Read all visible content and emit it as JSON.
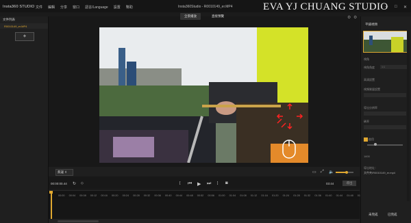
{
  "app": {
    "name": "Insta360 STUDIO",
    "document_title": "Insta360Studio - R0010149_er.MP4",
    "watermark": "EVA YJ CHUANG STUDIO"
  },
  "menu": [
    "文件",
    "編輯",
    "分享",
    "窗口",
    "語言/Language",
    "設置",
    "幫助"
  ],
  "window_controls": {
    "minimize": "─",
    "maximize": "□",
    "close": "✕"
  },
  "left_panel": {
    "header": "文件列表",
    "files": [
      "R0010149_er.MP4"
    ],
    "add_label": "+"
  },
  "view_modes": {
    "active": "全景播放",
    "other": "直接預覽"
  },
  "controls": {
    "dropdown_value": "無邊 ⇕",
    "time_current": "00:00:00.44",
    "time_total": "03:44",
    "export_label": "導出",
    "volume_level": 0.6
  },
  "ruler_ticks": [
    "00:00",
    "00:04",
    "00:08",
    "00:12",
    "00:16",
    "00:20",
    "00:24",
    "00:28",
    "00:32",
    "00:36",
    "00:40",
    "00:44",
    "00:48",
    "00:52",
    "00:56",
    "01:00",
    "01:04",
    "01:08",
    "01:12",
    "01:16",
    "01:20",
    "01:24",
    "01:28",
    "01:32",
    "01:36",
    "01:40",
    "01:44",
    "01:48",
    "01:52"
  ],
  "right_panel": {
    "title": "平鋪視頻",
    "section1": "視角",
    "field1_label": "視角角度",
    "field1_value": "1:1",
    "section2": "高清設置",
    "line1": "視頻質量設置",
    "line2": "導出分辨率",
    "line3": "碼率",
    "check_label": "啟用",
    "slider_label": "1600",
    "info": "導出地址：",
    "info2": "文件夾/R0010149_er.mp4",
    "footer_left": "未完成",
    "footer_right": "已完成"
  }
}
